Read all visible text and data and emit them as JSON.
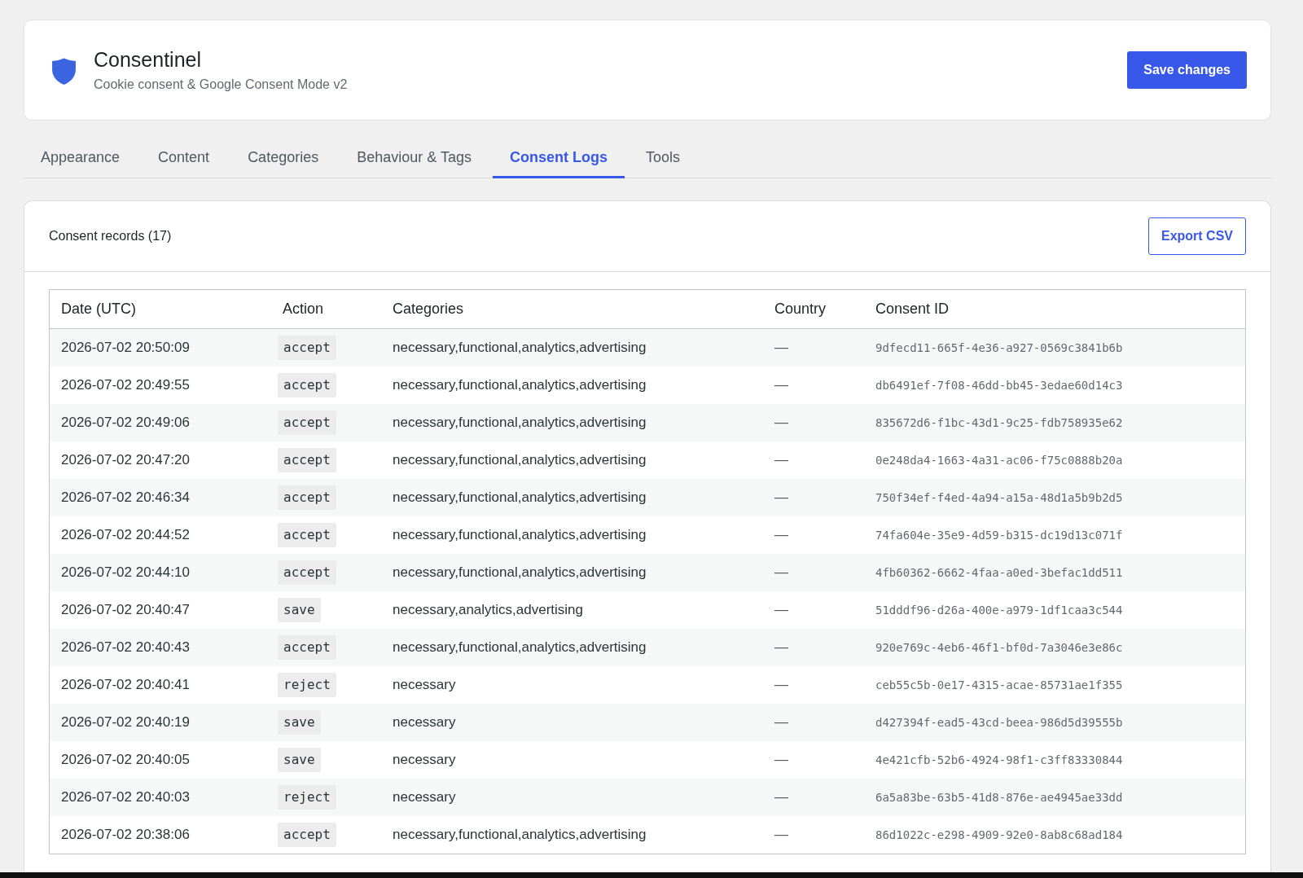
{
  "header": {
    "title": "Consentinel",
    "subtitle": "Cookie consent & Google Consent Mode v2",
    "save_button": "Save changes"
  },
  "tabs": [
    {
      "label": "Appearance",
      "selected": false
    },
    {
      "label": "Content",
      "selected": false
    },
    {
      "label": "Categories",
      "selected": false
    },
    {
      "label": "Behaviour & Tags",
      "selected": false
    },
    {
      "label": "Consent Logs",
      "selected": true
    },
    {
      "label": "Tools",
      "selected": false
    }
  ],
  "panel": {
    "title": "Consent records (17)",
    "export_button": "Export CSV",
    "table": {
      "columns": [
        "Date (UTC)",
        "Action",
        "Categories",
        "Country",
        "Consent ID"
      ],
      "rows": [
        {
          "date": "2026-07-02 20:50:09",
          "action": "accept",
          "categories": "necessary,functional,analytics,advertising",
          "country": "—",
          "consent_id": "9dfecd11-665f-4e36-a927-0569c3841b6b"
        },
        {
          "date": "2026-07-02 20:49:55",
          "action": "accept",
          "categories": "necessary,functional,analytics,advertising",
          "country": "—",
          "consent_id": "db6491ef-7f08-46dd-bb45-3edae60d14c3"
        },
        {
          "date": "2026-07-02 20:49:06",
          "action": "accept",
          "categories": "necessary,functional,analytics,advertising",
          "country": "—",
          "consent_id": "835672d6-f1bc-43d1-9c25-fdb758935e62"
        },
        {
          "date": "2026-07-02 20:47:20",
          "action": "accept",
          "categories": "necessary,functional,analytics,advertising",
          "country": "—",
          "consent_id": "0e248da4-1663-4a31-ac06-f75c0888b20a"
        },
        {
          "date": "2026-07-02 20:46:34",
          "action": "accept",
          "categories": "necessary,functional,analytics,advertising",
          "country": "—",
          "consent_id": "750f34ef-f4ed-4a94-a15a-48d1a5b9b2d5"
        },
        {
          "date": "2026-07-02 20:44:52",
          "action": "accept",
          "categories": "necessary,functional,analytics,advertising",
          "country": "—",
          "consent_id": "74fa604e-35e9-4d59-b315-dc19d13c071f"
        },
        {
          "date": "2026-07-02 20:44:10",
          "action": "accept",
          "categories": "necessary,functional,analytics,advertising",
          "country": "—",
          "consent_id": "4fb60362-6662-4faa-a0ed-3befac1dd511"
        },
        {
          "date": "2026-07-02 20:40:47",
          "action": "save",
          "categories": "necessary,analytics,advertising",
          "country": "—",
          "consent_id": "51dddf96-d26a-400e-a979-1df1caa3c544"
        },
        {
          "date": "2026-07-02 20:40:43",
          "action": "accept",
          "categories": "necessary,functional,analytics,advertising",
          "country": "—",
          "consent_id": "920e769c-4eb6-46f1-bf0d-7a3046e3e86c"
        },
        {
          "date": "2026-07-02 20:40:41",
          "action": "reject",
          "categories": "necessary",
          "country": "—",
          "consent_id": "ceb55c5b-0e17-4315-acae-85731ae1f355"
        },
        {
          "date": "2026-07-02 20:40:19",
          "action": "save",
          "categories": "necessary",
          "country": "—",
          "consent_id": "d427394f-ead5-43cd-beea-986d5d39555b"
        },
        {
          "date": "2026-07-02 20:40:05",
          "action": "save",
          "categories": "necessary",
          "country": "—",
          "consent_id": "4e421cfb-52b6-4924-98f1-c3ff83330844"
        },
        {
          "date": "2026-07-02 20:40:03",
          "action": "reject",
          "categories": "necessary",
          "country": "—",
          "consent_id": "6a5a83be-63b5-41d8-876e-ae4945ae33dd"
        },
        {
          "date": "2026-07-02 20:38:06",
          "action": "accept",
          "categories": "necessary,functional,analytics,advertising",
          "country": "—",
          "consent_id": "86d1022c-e298-4909-92e0-8ab8c68ad184"
        }
      ]
    }
  }
}
